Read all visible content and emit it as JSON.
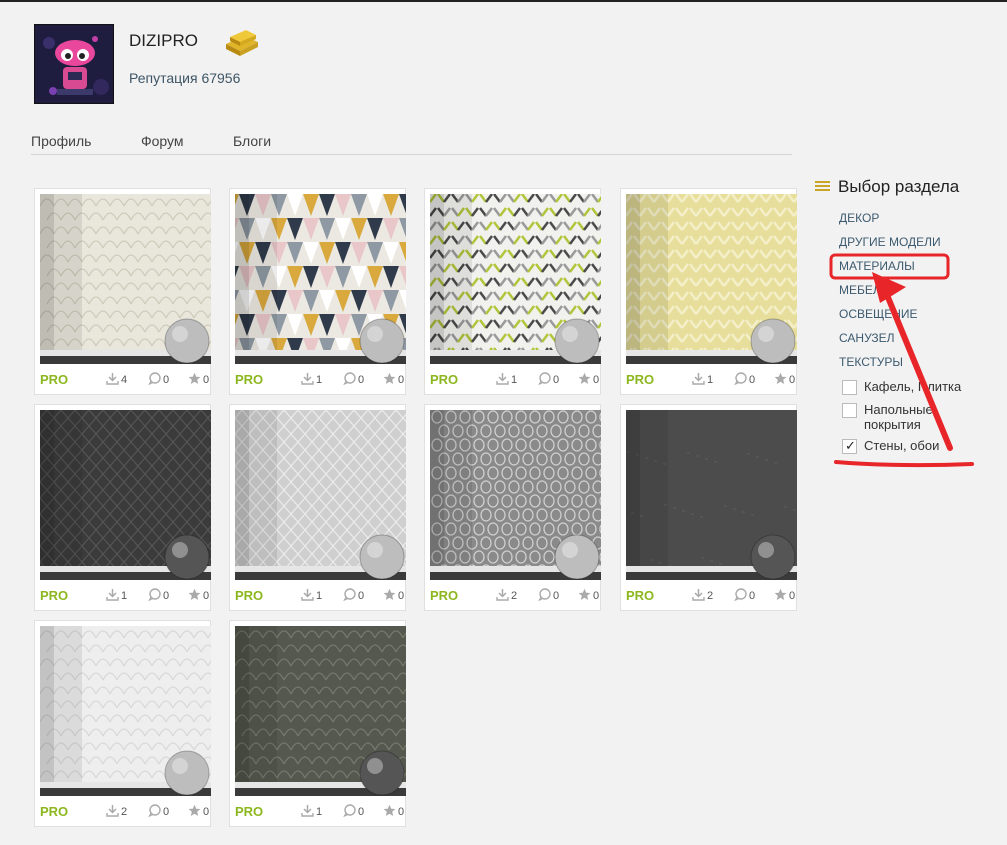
{
  "profile": {
    "username": "DIZIPRO",
    "reputation": "Репутация 67956"
  },
  "nav": [
    {
      "label": "Профиль"
    },
    {
      "label": "Форум"
    },
    {
      "label": "Блоги"
    }
  ],
  "items": [
    {
      "badge": "PRO",
      "downloads": "4",
      "comments": "0",
      "likes": "0",
      "pattern": "fan-beige"
    },
    {
      "badge": "PRO",
      "downloads": "1",
      "comments": "0",
      "likes": "0",
      "pattern": "triangles-color"
    },
    {
      "badge": "PRO",
      "downloads": "1",
      "comments": "0",
      "likes": "0",
      "pattern": "chevron-lime"
    },
    {
      "badge": "PRO",
      "downloads": "1",
      "comments": "0",
      "likes": "0",
      "pattern": "chevron-yellow"
    },
    {
      "badge": "PRO",
      "downloads": "1",
      "comments": "0",
      "likes": "0",
      "pattern": "damask-dark"
    },
    {
      "badge": "PRO",
      "downloads": "1",
      "comments": "0",
      "likes": "0",
      "pattern": "diamond-grey"
    },
    {
      "badge": "PRO",
      "downloads": "2",
      "comments": "0",
      "likes": "0",
      "pattern": "ogee-grey"
    },
    {
      "badge": "PRO",
      "downloads": "2",
      "comments": "0",
      "likes": "0",
      "pattern": "plain-dark"
    },
    {
      "badge": "PRO",
      "downloads": "2",
      "comments": "0",
      "likes": "0",
      "pattern": "fan-white"
    },
    {
      "badge": "PRO",
      "downloads": "1",
      "comments": "0",
      "likes": "0",
      "pattern": "fan-olive"
    }
  ],
  "sidebar": {
    "title": "Выбор раздела",
    "links": [
      {
        "label": "ДЕКОР"
      },
      {
        "label": "ДРУГИЕ МОДЕЛИ"
      },
      {
        "label": "МАТЕРИАЛЫ"
      },
      {
        "label": "МЕБЕЛЬ"
      },
      {
        "label": "ОСВЕЩЕНИЕ"
      },
      {
        "label": "САНУЗЕЛ"
      },
      {
        "label": "ТЕКСТУРЫ"
      }
    ],
    "filters": [
      {
        "label": "Кафель, Плитка",
        "checked": false
      },
      {
        "label": "Напольные покрытия",
        "checked": false
      },
      {
        "label": "Стены, обои",
        "checked": true
      }
    ]
  },
  "colors": {
    "pro_badge": "#8cb71e",
    "annotation_red": "#e8262a",
    "menu_icon": "#caa424"
  }
}
